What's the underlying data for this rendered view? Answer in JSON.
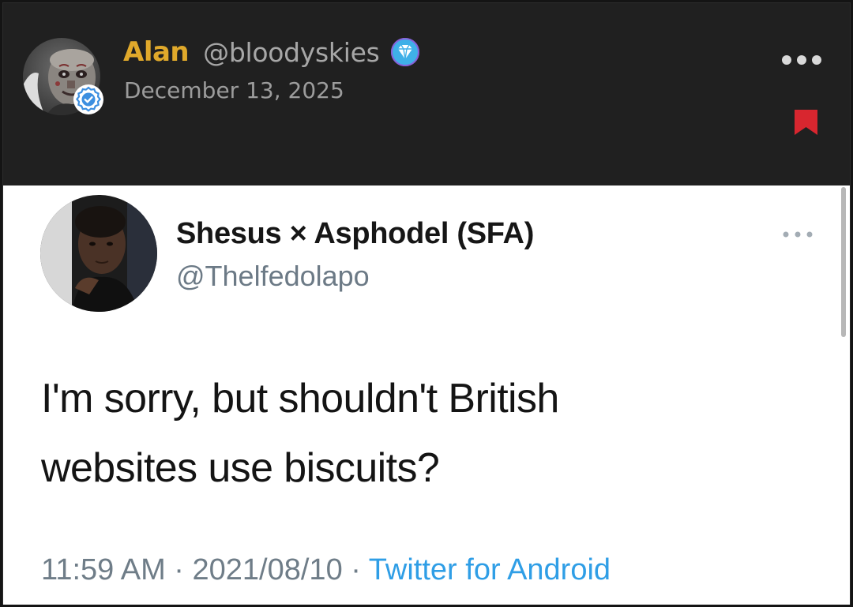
{
  "post": {
    "author_name": "Alan",
    "author_handle": "@bloodyskies",
    "date": "December 13, 2025",
    "avatar_icon": "zombie-face-avatar",
    "badge_icon": "verified-check-icon",
    "gem_icon": "diamond-gem-icon",
    "more_icon": "more-options-icon",
    "bookmark_icon": "bookmark-icon",
    "colors": {
      "author_name": "#e0a92b",
      "background": "#202020",
      "bookmark": "#d8262f",
      "gem": "#3fb0e8",
      "verified": "#3d8fe0"
    }
  },
  "tweet": {
    "display_name": "Shesus × Asphodel (SFA)",
    "handle": "@Thelfedolapo",
    "text_line1": "I'm sorry, but shouldn't British",
    "text_line2": "websites use biscuits?",
    "time": "11:59 AM",
    "separator": "·",
    "date": "2021/08/10",
    "source": "Twitter for Android",
    "colors": {
      "handle": "#6c7a86",
      "source": "#2f9ee6"
    }
  }
}
